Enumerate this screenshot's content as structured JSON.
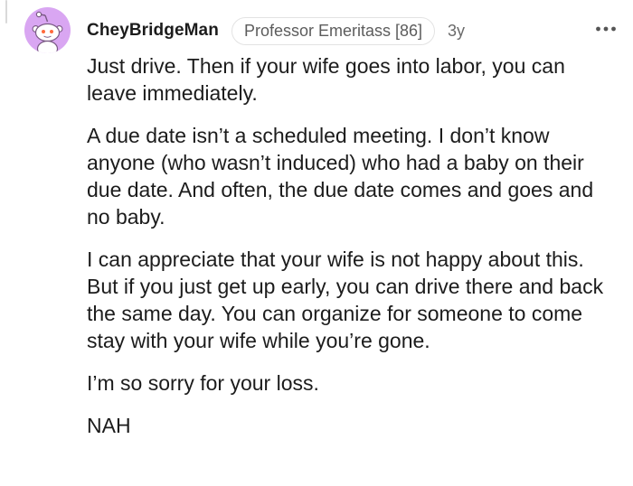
{
  "comment": {
    "username": "CheyBridgeMan",
    "flair": "Professor Emeritass [86]",
    "timestamp": "3y",
    "paragraphs": [
      "Just drive. Then if your wife goes into labor, you can leave immediately.",
      "A due date isn’t a scheduled meeting. I don’t know anyone (who wasn’t induced) who had a baby on their due date. And often, the due date comes and goes and no baby.",
      "I can appreciate that your wife is not happy about this. But if you just get up early, you can drive there and back the same day. You can organize for someone to come stay with your wife while you’re gone.",
      "I’m so sorry for your loss.",
      "NAH"
    ]
  },
  "icons": {
    "avatar": "snoo-avatar-icon",
    "more": "more-options-icon"
  },
  "colors": {
    "avatar_background": "#d9a6f2",
    "text": "#1c1c1c",
    "flair_text": "#5c5c5c",
    "flair_border": "#e3e3e3"
  }
}
